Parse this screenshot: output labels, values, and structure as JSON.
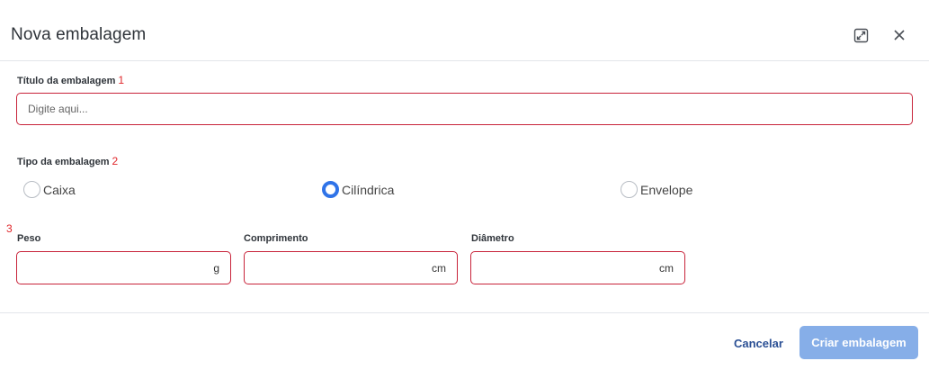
{
  "dialog": {
    "title": "Nova embalagem",
    "expand_icon": "expand-icon",
    "close_icon": "close-icon"
  },
  "form": {
    "title_field": {
      "label": "Título da embalagem",
      "step": "1",
      "placeholder": "Digite aqui...",
      "value": ""
    },
    "type_field": {
      "label": "Tipo da embalagem",
      "step": "2",
      "options": [
        {
          "label": "Caixa",
          "selected": false
        },
        {
          "label": "Cilíndrica",
          "selected": true
        },
        {
          "label": "Envelope",
          "selected": false
        }
      ]
    },
    "dimensions_step": "3",
    "weight": {
      "label": "Peso",
      "unit": "g",
      "value": ""
    },
    "length": {
      "label": "Comprimento",
      "unit": "cm",
      "value": ""
    },
    "diameter": {
      "label": "Diâmetro",
      "unit": "cm",
      "value": ""
    }
  },
  "footer": {
    "cancel_label": "Cancelar",
    "create_label": "Criar embalagem"
  },
  "colors": {
    "accent": "#2f73e8",
    "error_border": "#c8233a",
    "required_marker": "#e0262a",
    "primary_disabled": "#86aee8",
    "link": "#2a4f94"
  }
}
